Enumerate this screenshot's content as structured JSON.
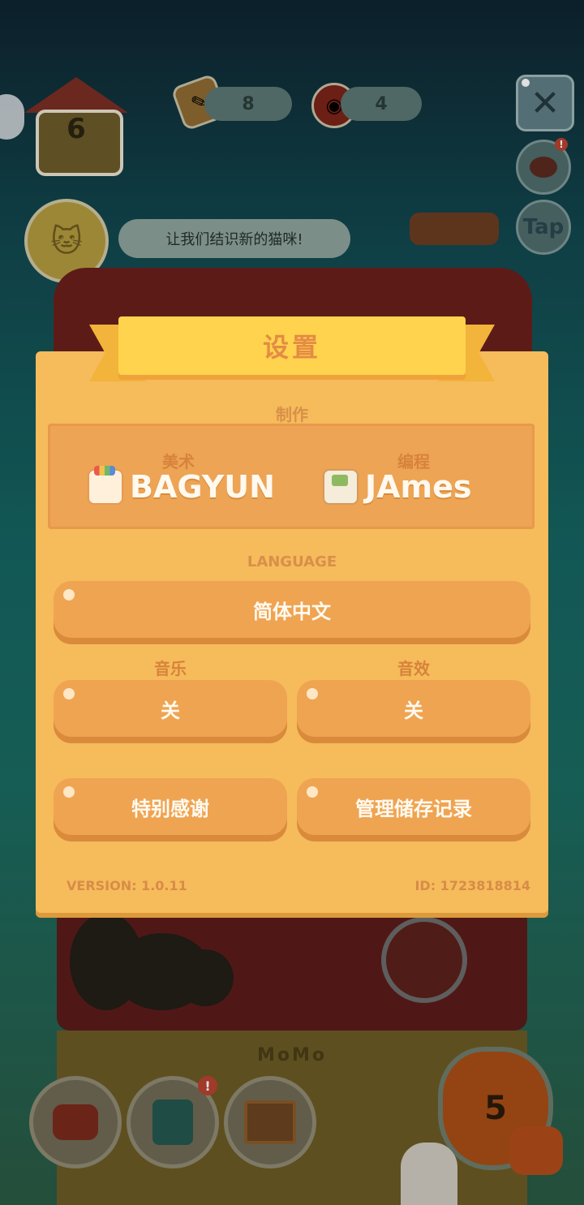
{
  "hud": {
    "house_level": "6",
    "pencil_count": "8",
    "can_count": "4",
    "close_icon": "close-icon",
    "tap_label": "Tap",
    "speech_text": "让我们结识新的猫咪!",
    "notification_mark": "!"
  },
  "scene": {
    "floor_label": "MoMo",
    "counter_value": "5"
  },
  "settings": {
    "title": "设置",
    "credits_heading": "制作",
    "credits": [
      {
        "role": "美术",
        "name": "BAGYUN",
        "icon": "palette-icon"
      },
      {
        "role": "编程",
        "name": "JAmes",
        "icon": "gameboy-icon"
      }
    ],
    "language_heading": "LANGUAGE",
    "language_value": "简体中文",
    "music_heading": "音乐",
    "music_value": "关",
    "sfx_heading": "音效",
    "sfx_value": "关",
    "special_thanks_label": "特别感谢",
    "manage_saves_label": "管理储存记录",
    "version_text": "VERSION: 1.0.11",
    "id_text": "ID: 1723818814"
  },
  "colors": {
    "modal_bg": "#f6bb5b",
    "button_bg": "#efa452",
    "ribbon": "#ffd34d",
    "title_text": "#e48b45"
  }
}
